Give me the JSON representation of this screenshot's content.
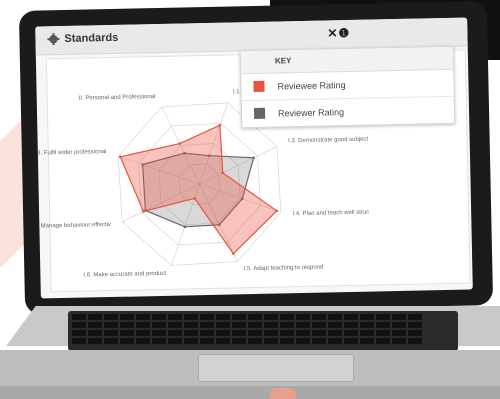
{
  "window": {
    "title": "Standards",
    "tools_text": "✕❶"
  },
  "key": {
    "title": "KEY",
    "items": [
      {
        "label": "Reviewee Rating",
        "color": "#e8533f"
      },
      {
        "label": "Reviewer Rating",
        "color": "#666666"
      }
    ]
  },
  "chart_data": {
    "type": "radar",
    "axes": [
      "I.1. Set high expectations whi",
      "I.3. Demonstrate good subject",
      "I.4. Plan and teach well struc",
      "I.5. Adapt teaching to respond",
      "I.6. Make accurate and product",
      "I.7. Manage behaviour effectiv",
      "I.8. Fulfil wider professional",
      "II. Personal and Professional"
    ],
    "max": 4,
    "series": [
      {
        "name": "Reviewee Rating",
        "color": "#e8533f",
        "values": [
          2.9,
          1.2,
          3.8,
          3.6,
          0.7,
          2.9,
          3.9,
          2.1
        ]
      },
      {
        "name": "Reviewer Rating",
        "color": "#666666",
        "values": [
          1.4,
          2.8,
          2.1,
          2.1,
          2.1,
          2.8,
          2.8,
          1.6
        ]
      }
    ]
  }
}
